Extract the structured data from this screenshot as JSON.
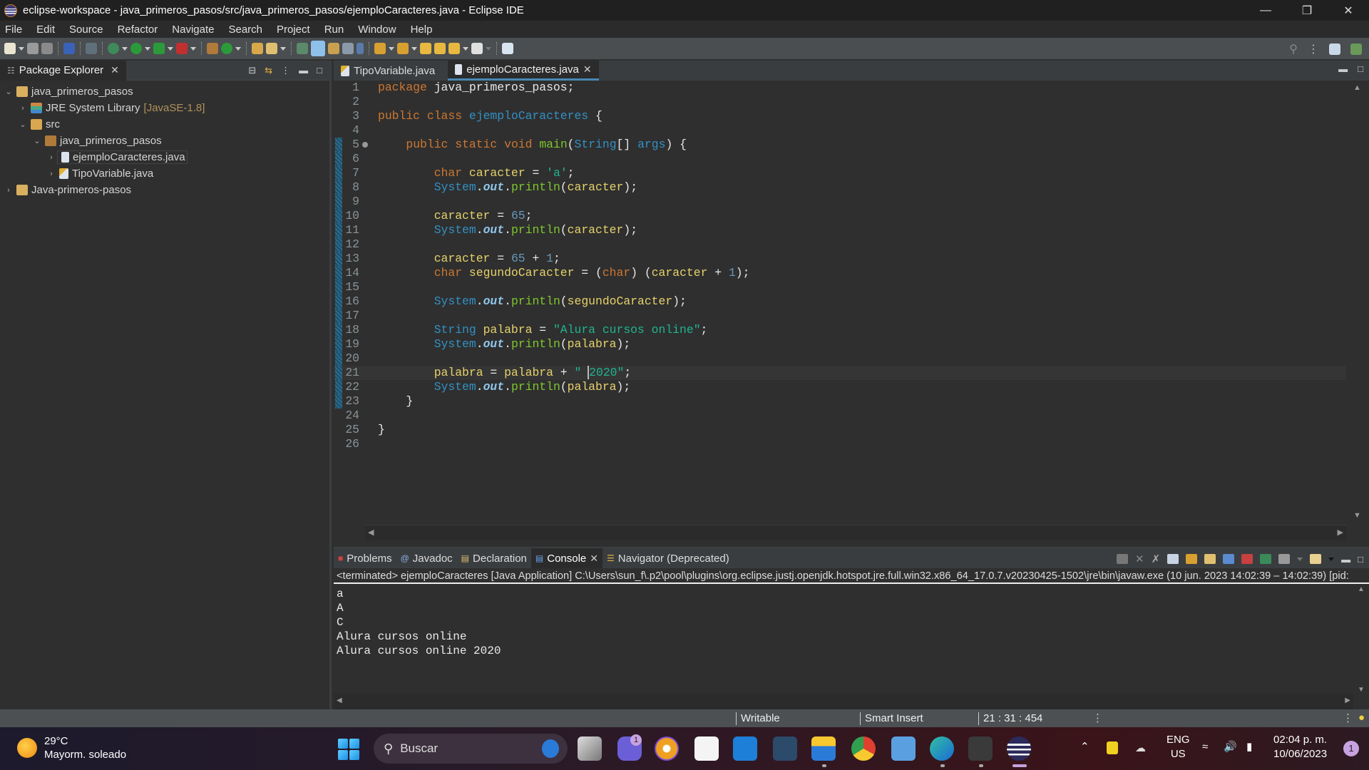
{
  "window": {
    "title": "eclipse-workspace - java_primeros_pasos/src/java_primeros_pasos/ejemploCaracteres.java - Eclipse IDE",
    "controls": [
      "minimize",
      "restore",
      "close"
    ]
  },
  "menu": [
    "File",
    "Edit",
    "Source",
    "Refactor",
    "Navigate",
    "Search",
    "Project",
    "Run",
    "Window",
    "Help"
  ],
  "package_explorer": {
    "title": "Package Explorer",
    "tree": [
      {
        "label": "java_primeros_pasos",
        "level": 0,
        "expanded": true,
        "icon": "project-icon"
      },
      {
        "label": "JRE System Library",
        "decoration": "[JavaSE-1.8]",
        "level": 1,
        "expanded": false,
        "icon": "library-icon"
      },
      {
        "label": "src",
        "level": 1,
        "expanded": true,
        "icon": "source-folder-icon"
      },
      {
        "label": "java_primeros_pasos",
        "level": 2,
        "expanded": true,
        "icon": "package-icon"
      },
      {
        "label": "ejemploCaracteres.java",
        "level": 3,
        "expanded": false,
        "icon": "java-file-icon",
        "selected": true
      },
      {
        "label": "TipoVariable.java",
        "level": 3,
        "expanded": false,
        "icon": "java-file-warning-icon"
      },
      {
        "label": "Java-primeros-pasos",
        "level": 0,
        "expanded": false,
        "icon": "project-icon"
      }
    ]
  },
  "editor": {
    "tabs": [
      {
        "label": "TipoVariable.java",
        "active": false
      },
      {
        "label": "ejemploCaracteres.java",
        "active": true
      }
    ],
    "current_line": 21,
    "lines": [
      "package java_primeros_pasos;",
      "",
      "public class ejemploCaracteres {",
      "",
      "    public static void main(String[] args) {",
      "",
      "        char caracter = 'a';",
      "        System.out.println(caracter);",
      "",
      "        caracter = 65;",
      "        System.out.println(caracter);",
      "",
      "        caracter = 65 + 1;",
      "        char segundoCaracter = (char) (caracter + 1);",
      "",
      "        System.out.println(segundoCaracter);",
      "",
      "        String palabra = \"Alura cursos online\";",
      "        System.out.println(palabra);",
      "",
      "        palabra = palabra + \" 2020\";",
      "        System.out.println(palabra);",
      "    }",
      "",
      "}",
      ""
    ]
  },
  "console": {
    "tabs": [
      {
        "label": "Problems",
        "active": false
      },
      {
        "label": "Javadoc",
        "active": false
      },
      {
        "label": "Declaration",
        "active": false
      },
      {
        "label": "Console",
        "active": true
      },
      {
        "label": "Navigator (Deprecated)",
        "active": false
      }
    ],
    "terminated_line": "<terminated> ejemploCaracteres [Java Application] C:\\Users\\sun_f\\.p2\\pool\\plugins\\org.eclipse.justj.openjdk.hotspot.jre.full.win32.x86_64_17.0.7.v20230425-1502\\jre\\bin\\javaw.exe  (10 jun. 2023 14:02:39 – 14:02:39) [pid:",
    "output": [
      "a",
      "A",
      "C",
      "Alura cursos online",
      "Alura cursos online 2020"
    ]
  },
  "statusbar": {
    "writable": "Writable",
    "insert_mode": "Smart Insert",
    "position": "21 : 31 : 454"
  },
  "taskbar": {
    "weather_temp": "29°C",
    "weather_desc": "Mayorm. soleado",
    "search_label": "Buscar",
    "chat_badge": "1",
    "lang_top": "ENG",
    "lang_bottom": "US",
    "time": "02:04 p. m.",
    "date": "10/06/2023",
    "notifications": "1"
  }
}
